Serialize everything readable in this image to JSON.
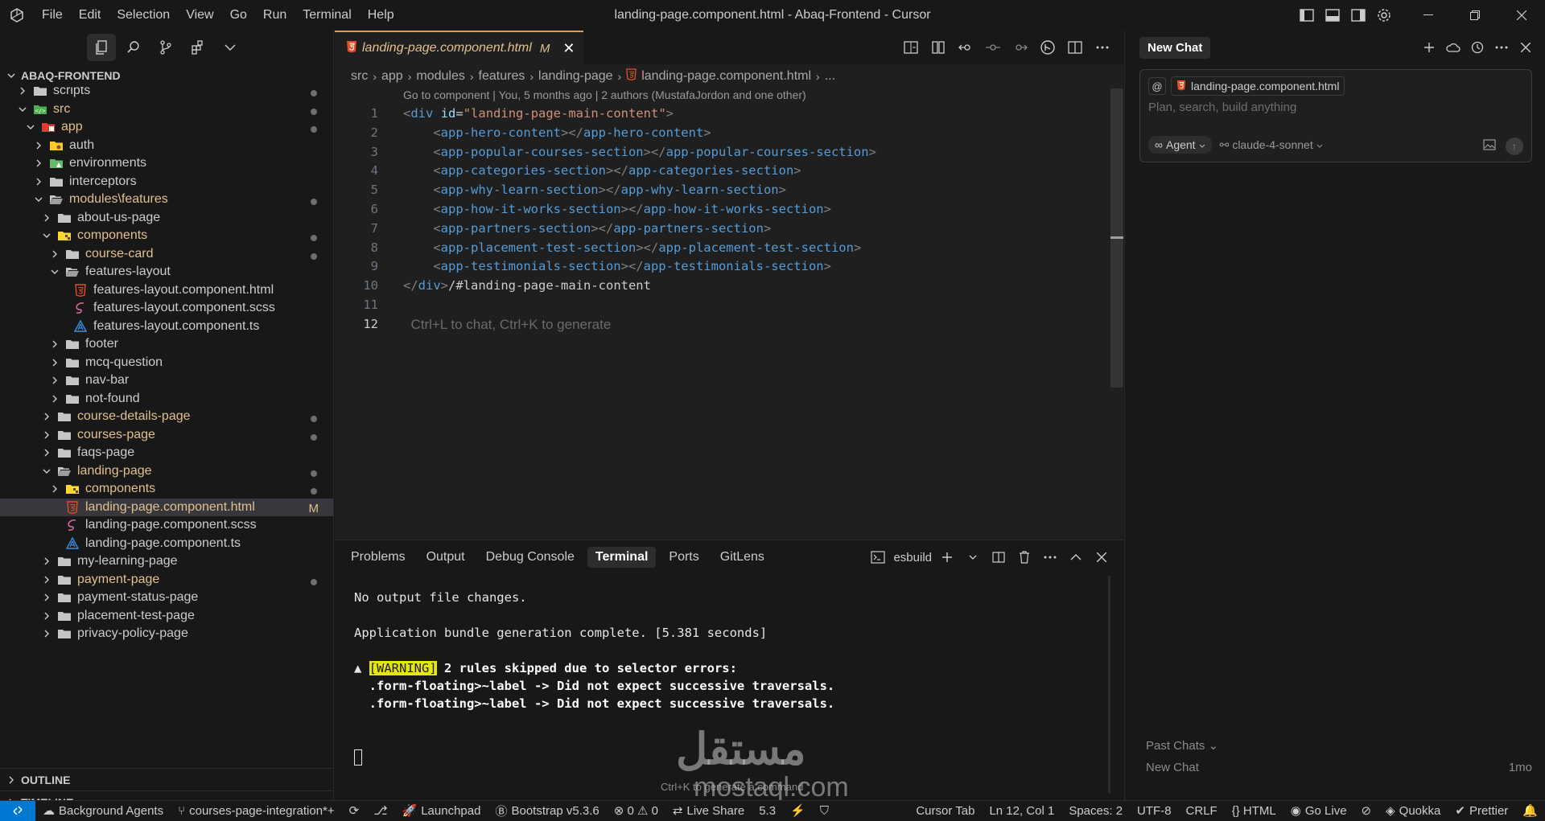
{
  "window": {
    "title": "landing-page.component.html - Abaq-Frontend - Cursor",
    "menu": [
      "File",
      "Edit",
      "Selection",
      "View",
      "Go",
      "Run",
      "Terminal",
      "Help"
    ]
  },
  "explorer": {
    "project": "ABAQ-FRONTEND",
    "tree": [
      {
        "label": "scripts",
        "depth": 1,
        "kind": "folder",
        "open": false,
        "dot": true,
        "cut": true
      },
      {
        "label": "src",
        "depth": 1,
        "kind": "folder-src",
        "open": true,
        "dot": true,
        "mod": true
      },
      {
        "label": "app",
        "depth": 2,
        "kind": "folder-app",
        "open": true,
        "dot": true,
        "mod": true
      },
      {
        "label": "auth",
        "depth": 3,
        "kind": "folder-auth",
        "open": false
      },
      {
        "label": "environments",
        "depth": 3,
        "kind": "folder-env",
        "open": false
      },
      {
        "label": "interceptors",
        "depth": 3,
        "kind": "folder",
        "open": false
      },
      {
        "label": "modules\\features",
        "depth": 3,
        "kind": "folder",
        "open": true,
        "dot": true,
        "mod": true
      },
      {
        "label": "about-us-page",
        "depth": 4,
        "kind": "folder",
        "open": false
      },
      {
        "label": "components",
        "depth": 4,
        "kind": "folder-comp",
        "open": true,
        "dot": true,
        "mod": true
      },
      {
        "label": "course-card",
        "depth": 5,
        "kind": "folder",
        "open": false,
        "dot": true,
        "mod": true
      },
      {
        "label": "features-layout",
        "depth": 5,
        "kind": "folder",
        "open": true
      },
      {
        "label": "features-layout.component.html",
        "depth": 6,
        "kind": "html"
      },
      {
        "label": "features-layout.component.scss",
        "depth": 6,
        "kind": "scss"
      },
      {
        "label": "features-layout.component.ts",
        "depth": 6,
        "kind": "ts"
      },
      {
        "label": "footer",
        "depth": 5,
        "kind": "folder",
        "open": false
      },
      {
        "label": "mcq-question",
        "depth": 5,
        "kind": "folder",
        "open": false
      },
      {
        "label": "nav-bar",
        "depth": 5,
        "kind": "folder",
        "open": false
      },
      {
        "label": "not-found",
        "depth": 5,
        "kind": "folder",
        "open": false
      },
      {
        "label": "course-details-page",
        "depth": 4,
        "kind": "folder",
        "open": false,
        "dot": true,
        "mod": true
      },
      {
        "label": "courses-page",
        "depth": 4,
        "kind": "folder",
        "open": false,
        "dot": true,
        "mod": true
      },
      {
        "label": "faqs-page",
        "depth": 4,
        "kind": "folder",
        "open": false
      },
      {
        "label": "landing-page",
        "depth": 4,
        "kind": "folder",
        "open": true,
        "dot": true,
        "mod": true
      },
      {
        "label": "components",
        "depth": 5,
        "kind": "folder-comp",
        "open": false,
        "dot": true,
        "mod": true
      },
      {
        "label": "landing-page.component.html",
        "depth": 5,
        "kind": "html",
        "selected": true,
        "badge": "M",
        "mod": true
      },
      {
        "label": "landing-page.component.scss",
        "depth": 5,
        "kind": "scss"
      },
      {
        "label": "landing-page.component.ts",
        "depth": 5,
        "kind": "ts"
      },
      {
        "label": "my-learning-page",
        "depth": 4,
        "kind": "folder",
        "open": false
      },
      {
        "label": "payment-page",
        "depth": 4,
        "kind": "folder",
        "open": false,
        "dot": true,
        "mod": true
      },
      {
        "label": "payment-status-page",
        "depth": 4,
        "kind": "folder",
        "open": false
      },
      {
        "label": "placement-test-page",
        "depth": 4,
        "kind": "folder",
        "open": false
      },
      {
        "label": "privacy-policy-page",
        "depth": 4,
        "kind": "folder",
        "open": false
      }
    ],
    "outline": "OUTLINE",
    "timeline": "TIMELINE"
  },
  "editor": {
    "tab": {
      "label": "landing-page.component.html",
      "badge": "M"
    },
    "breadcrumb": [
      "src",
      "app",
      "modules",
      "features",
      "landing-page",
      "landing-page.component.html",
      "..."
    ],
    "codelens": "Go to component | You, 5 months ago | 2 authors (MustafaJordon and one other)",
    "lines": [
      {
        "n": "1",
        "parts": [
          [
            "t-br",
            "<"
          ],
          [
            "t-tag",
            "div"
          ],
          [
            "t-txt",
            " "
          ],
          [
            "t-attr",
            "id"
          ],
          [
            "t-txt",
            "="
          ],
          [
            "t-str",
            "\"landing-page-main-content\""
          ],
          [
            "t-br",
            ">"
          ]
        ]
      },
      {
        "n": "2",
        "parts": [
          [
            "t-txt",
            "    "
          ],
          [
            "t-br",
            "<"
          ],
          [
            "t-tag",
            "app-hero-content"
          ],
          [
            "t-br",
            "></"
          ],
          [
            "t-tag",
            "app-hero-content"
          ],
          [
            "t-br",
            ">"
          ]
        ]
      },
      {
        "n": "3",
        "parts": [
          [
            "t-txt",
            "    "
          ],
          [
            "t-br",
            "<"
          ],
          [
            "t-tag",
            "app-popular-courses-section"
          ],
          [
            "t-br",
            "></"
          ],
          [
            "t-tag",
            "app-popular-courses-section"
          ],
          [
            "t-br",
            ">"
          ]
        ]
      },
      {
        "n": "4",
        "parts": [
          [
            "t-txt",
            "    "
          ],
          [
            "t-br",
            "<"
          ],
          [
            "t-tag",
            "app-categories-section"
          ],
          [
            "t-br",
            "></"
          ],
          [
            "t-tag",
            "app-categories-section"
          ],
          [
            "t-br",
            ">"
          ]
        ]
      },
      {
        "n": "5",
        "parts": [
          [
            "t-txt",
            "    "
          ],
          [
            "t-br",
            "<"
          ],
          [
            "t-tag",
            "app-why-learn-section"
          ],
          [
            "t-br",
            "></"
          ],
          [
            "t-tag",
            "app-why-learn-section"
          ],
          [
            "t-br",
            ">"
          ]
        ]
      },
      {
        "n": "6",
        "parts": [
          [
            "t-txt",
            "    "
          ],
          [
            "t-br",
            "<"
          ],
          [
            "t-tag",
            "app-how-it-works-section"
          ],
          [
            "t-br",
            "></"
          ],
          [
            "t-tag",
            "app-how-it-works-section"
          ],
          [
            "t-br",
            ">"
          ]
        ]
      },
      {
        "n": "7",
        "parts": [
          [
            "t-txt",
            "    "
          ],
          [
            "t-br",
            "<"
          ],
          [
            "t-tag",
            "app-partners-section"
          ],
          [
            "t-br",
            "></"
          ],
          [
            "t-tag",
            "app-partners-section"
          ],
          [
            "t-br",
            ">"
          ]
        ]
      },
      {
        "n": "8",
        "parts": [
          [
            "t-txt",
            "    "
          ],
          [
            "t-br",
            "<"
          ],
          [
            "t-tag",
            "app-placement-test-section"
          ],
          [
            "t-br",
            "></"
          ],
          [
            "t-tag",
            "app-placement-test-section"
          ],
          [
            "t-br",
            ">"
          ]
        ]
      },
      {
        "n": "9",
        "parts": [
          [
            "t-txt",
            "    "
          ],
          [
            "t-br",
            "<"
          ],
          [
            "t-tag",
            "app-testimonials-section"
          ],
          [
            "t-br",
            "></"
          ],
          [
            "t-tag",
            "app-testimonials-section"
          ],
          [
            "t-br",
            ">"
          ]
        ]
      },
      {
        "n": "10",
        "parts": [
          [
            "t-br",
            "</"
          ],
          [
            "t-tag",
            "div"
          ],
          [
            "t-br",
            ">"
          ],
          [
            "t-txt",
            "/#landing-page-main-content"
          ]
        ]
      },
      {
        "n": "11",
        "parts": []
      },
      {
        "n": "12",
        "parts": [
          [
            "hint",
            "  Ctrl+L to chat, Ctrl+K to generate"
          ]
        ],
        "current": true
      }
    ]
  },
  "panel": {
    "tabs": [
      "Problems",
      "Output",
      "Debug Console",
      "Terminal",
      "Ports",
      "GitLens"
    ],
    "active_tab": "Terminal",
    "terminal_name": "esbuild",
    "output": [
      "No output file changes.",
      "",
      "Application bundle generation complete. [5.381 seconds]",
      ""
    ],
    "warning_prefix": "▲ ",
    "warning_tag": "[WARNING]",
    "warning_msg": " 2 rules skipped due to selector errors:",
    "warning_lines": [
      "  .form-floating>~label -> Did not expect successive traversals.",
      "  .form-floating>~label -> Did not expect successive traversals."
    ],
    "hint": "Ctrl+K to generate a command"
  },
  "chat": {
    "tab": "New Chat",
    "context_at": "@",
    "context_file": "landing-page.component.html",
    "placeholder": "Plan, search, build anything",
    "mode": "Agent",
    "model": "claude-4-sonnet",
    "past_chats_label": "Past Chats",
    "history": [
      {
        "title": "New Chat",
        "age": "1mo"
      }
    ]
  },
  "statusbar": {
    "items_left": [
      {
        "icon": "cloud-icon",
        "label": "Background Agents"
      },
      {
        "icon": "git-branch-icon",
        "label": "courses-page-integration*+"
      },
      {
        "icon": "sync-icon",
        "label": ""
      },
      {
        "icon": "source-control-icon",
        "label": ""
      },
      {
        "icon": "rocket-icon",
        "label": "Launchpad"
      },
      {
        "icon": "bootstrap-icon",
        "label": "Bootstrap v5.3.6"
      },
      {
        "icon": "errors-icon",
        "label": "⊗ 0 ⚠ 0"
      },
      {
        "icon": "live-share-icon",
        "label": "Live Share"
      },
      {
        "icon": "",
        "label": "5.3"
      },
      {
        "icon": "bolt-icon",
        "label": ""
      },
      {
        "icon": "shield-check-icon",
        "label": ""
      }
    ],
    "items_right": [
      {
        "icon": "",
        "label": "Cursor Tab"
      },
      {
        "icon": "",
        "label": "Ln 12, Col 1"
      },
      {
        "icon": "",
        "label": "Spaces: 2"
      },
      {
        "icon": "",
        "label": "UTF-8"
      },
      {
        "icon": "",
        "label": "CRLF"
      },
      {
        "icon": "braces-icon",
        "label": "{} HTML"
      },
      {
        "icon": "broadcast-icon",
        "label": "Go Live"
      },
      {
        "icon": "no-eye-icon",
        "label": ""
      },
      {
        "icon": "quokka-icon",
        "label": "Quokka"
      },
      {
        "icon": "check-all-icon",
        "label": "Prettier"
      },
      {
        "icon": "bell-icon",
        "label": ""
      }
    ]
  },
  "watermark": {
    "line1": "مستقل",
    "line2": "mostaql.com"
  },
  "colors": {
    "accent": "#0078d4",
    "modified": "#e2c08d",
    "html": "#e44d26",
    "ts": "#3178c6",
    "scss": "#cd6799"
  }
}
